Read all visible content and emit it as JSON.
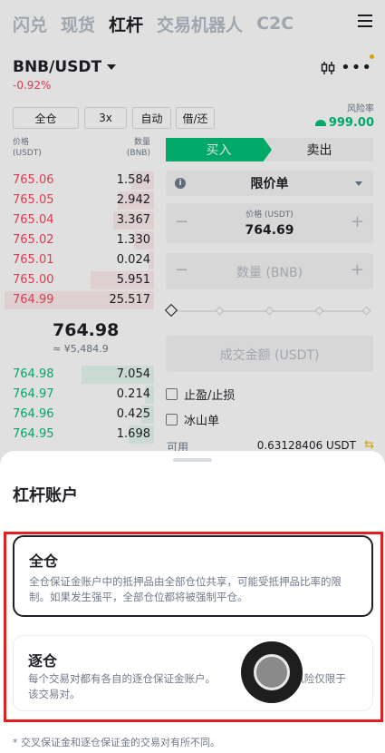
{
  "nav": {
    "tabs": [
      {
        "label": "闪兑",
        "active": false
      },
      {
        "label": "现货",
        "active": false
      },
      {
        "label": "杠杆",
        "active": true
      },
      {
        "label": "交易机器人",
        "active": false
      },
      {
        "label": "C2C",
        "active": false
      }
    ]
  },
  "pair": {
    "symbol": "BNB/USDT",
    "change": "-0.92%"
  },
  "controls": {
    "margin_mode": "全仓",
    "leverage": "3x",
    "auto": "自动",
    "borrow": "借/还"
  },
  "risk": {
    "label": "风险率",
    "value": "999.00"
  },
  "orderbook": {
    "price_header": "价格",
    "price_unit": "(USDT)",
    "qty_header": "数量",
    "qty_unit": "(BNB)",
    "asks": [
      {
        "price": "765.06",
        "qty": "1.584"
      },
      {
        "price": "765.05",
        "qty": "2.942"
      },
      {
        "price": "765.04",
        "qty": "3.367"
      },
      {
        "price": "765.02",
        "qty": "1.330"
      },
      {
        "price": "765.01",
        "qty": "0.024"
      },
      {
        "price": "765.00",
        "qty": "5.951"
      },
      {
        "price": "764.99",
        "qty": "25.517"
      }
    ],
    "last_price": "764.98",
    "last_fiat": "≈ ¥5,484.9",
    "bids": [
      {
        "price": "764.98",
        "qty": "7.054"
      },
      {
        "price": "764.97",
        "qty": "0.214"
      },
      {
        "price": "764.96",
        "qty": "0.425"
      },
      {
        "price": "764.95",
        "qty": "1.698"
      }
    ]
  },
  "order_form": {
    "buy_label": "买入",
    "sell_label": "卖出",
    "order_type": "限价单",
    "price_label": "价格 (USDT)",
    "price_value": "764.69",
    "qty_placeholder": "数量 (BNB)",
    "total_placeholder": "成交金额 (USDT)",
    "tp_sl_label": "止盈/止损",
    "iceberg_label": "冰山单",
    "available_label": "可用",
    "available_value": "0.63128406 USDT"
  },
  "sheet": {
    "title": "杠杆账户",
    "options": [
      {
        "title": "全仓",
        "description": "全仓保证金账户中的抵押品由全部仓位共享，可能受抵押品比率的限制。如果发生强平，全部仓位都将被强制平仓。",
        "selected": true
      },
      {
        "title": "逐仓",
        "description": "每个交易对都有各自的逐仓保证金账户。　　　　　　仓，风险仅限于该交易对。",
        "selected": false
      }
    ],
    "footnote": "* 交叉保证金和逐仓保证金的交易对有所不同。"
  },
  "colors": {
    "buy": "#02c076",
    "sell": "#f6465d",
    "accent": "#f0b90b",
    "highlight": "#e02020"
  },
  "icons": [
    "menu-icon",
    "caret-down-icon",
    "candlestick-chart-icon",
    "more-icon",
    "gauge-icon",
    "info-icon",
    "swap-icon"
  ]
}
